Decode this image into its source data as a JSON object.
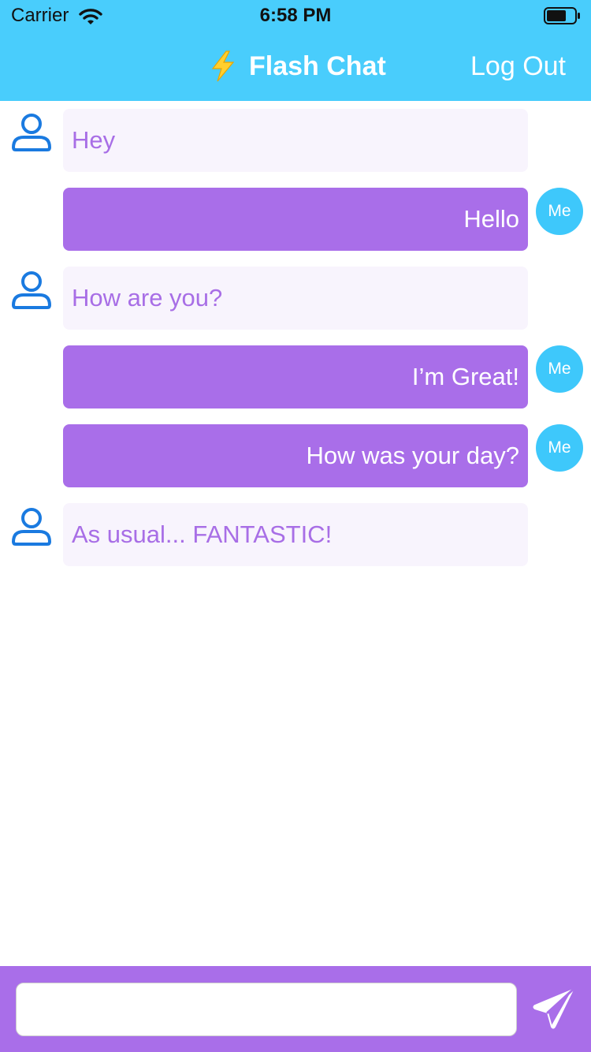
{
  "status_bar": {
    "carrier": "Carrier",
    "time": "6:58 PM"
  },
  "nav": {
    "title": "Flash Chat",
    "logout_label": "Log Out"
  },
  "messages": [
    {
      "sender": "other",
      "text": "Hey"
    },
    {
      "sender": "me",
      "text": "Hello",
      "avatar_label": "Me"
    },
    {
      "sender": "other",
      "text": "How are you?"
    },
    {
      "sender": "me",
      "text": "I’m Great!",
      "avatar_label": "Me"
    },
    {
      "sender": "me",
      "text": "How was your day?",
      "avatar_label": "Me"
    },
    {
      "sender": "other",
      "text": "As usual... FANTASTIC!"
    }
  ],
  "composer": {
    "value": "",
    "placeholder": ""
  },
  "colors": {
    "header": "#49cdfc",
    "brand_purple": "#a96ee9",
    "incoming_bubble": "#f8f4fd",
    "incoming_text": "#a86ee6",
    "me_avatar": "#3ec8fb",
    "person_icon": "#1a7ae0"
  },
  "icons": {
    "wifi": "wifi-icon",
    "battery": "battery-icon",
    "title": "lightning-bolt-icon",
    "other_avatar": "person-icon",
    "send": "paper-plane-icon"
  }
}
